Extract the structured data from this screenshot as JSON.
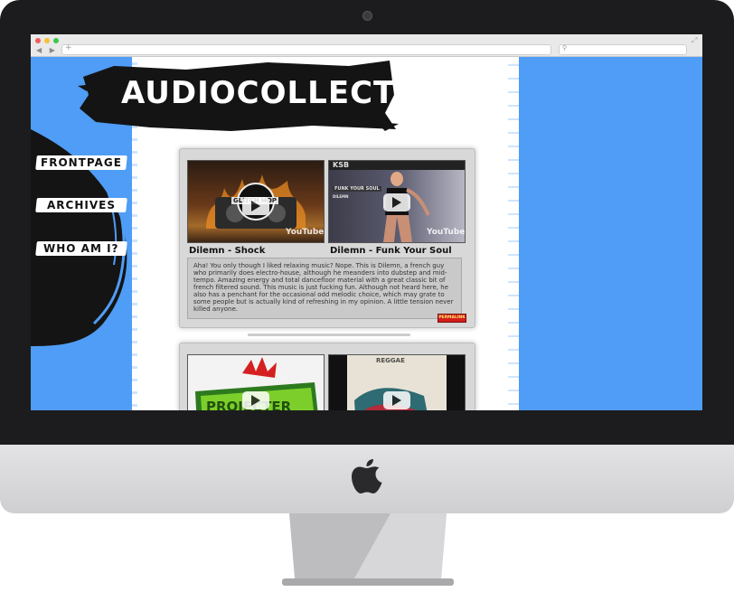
{
  "site": {
    "title": "AUDIOCOLLECTOR"
  },
  "nav": [
    {
      "label": "FRONTPAGE"
    },
    {
      "label": "ARCHIVES"
    },
    {
      "label": "WHO AM I?"
    }
  ],
  "posts": [
    {
      "left_title": "Dilemn - Shock",
      "right_title": "Dilemn - Funk Your Soul",
      "excerpt": "Aha! You only though I liked relaxing music? Nope. This is Dilemn, a french guy who primarily does electro-house, although he meanders into dubstep and mid-tempo. Amazing energy and total dancefloor material with a great classic bit of french filtered sound. This music is just fucking fun. Although not heard here, he also has a penchant for the occasional odd melodic choice, which may grate to some people but is actually kind of refreshing in my opinion. A little tension never killed anyone.",
      "read_more": "PERMALINK",
      "thumb_left": {
        "badge": "GLITCH HOP",
        "watermark": "YouTube"
      },
      "thumb_right": {
        "logo": "KSB",
        "caption": "FUNK YOUR SOUL",
        "sub": "DILEMN",
        "watermark": "YouTube"
      }
    },
    {
      "thumb_left": {
        "label": "PROJECTER"
      },
      "thumb_right": {
        "header": "REGGAE"
      }
    }
  ],
  "colors": {
    "page_bg": "#4f9df6",
    "content_bg": "#ffffff",
    "accent_red": "#d31c1c"
  },
  "icons": [
    "apple-logo-icon",
    "camera-icon",
    "play-icon",
    "search-icon",
    "plus-icon",
    "expand-icon"
  ]
}
